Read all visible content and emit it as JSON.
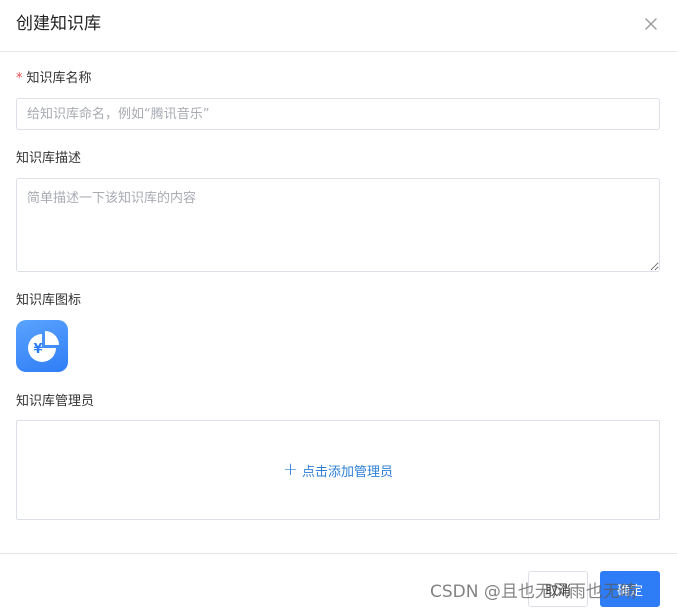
{
  "dialog": {
    "title": "创建知识库"
  },
  "fields": {
    "name": {
      "required_mark": "*",
      "label": "知识库名称",
      "placeholder": "给知识库命名，例如“腾讯音乐”",
      "value": ""
    },
    "description": {
      "label": "知识库描述",
      "placeholder": "简单描述一下该知识库的内容",
      "value": ""
    },
    "icon": {
      "label": "知识库图标",
      "icon_name": "yen-pie-chart-icon",
      "color": "#2f7df6"
    },
    "admins": {
      "label": "知识库管理员",
      "add_label": "点击添加管理员",
      "add_icon": "+"
    }
  },
  "footer": {
    "cancel_label": "取消",
    "ok_label": "确定"
  },
  "watermark": "CSDN @且也无风雨也无晴",
  "colors": {
    "accent": "#2f7df6",
    "link": "#2d7fd6",
    "required": "#e5484d",
    "border": "#dcdfe6"
  }
}
